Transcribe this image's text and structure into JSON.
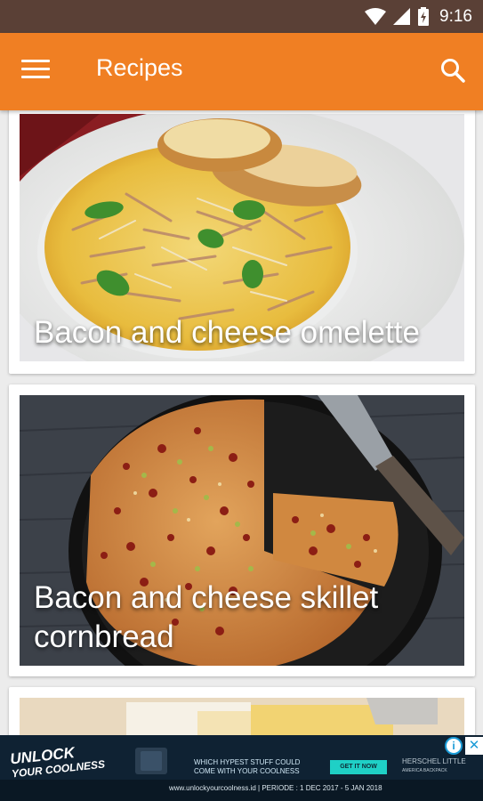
{
  "status_bar": {
    "time": "9:16"
  },
  "app_bar": {
    "title": "Recipes"
  },
  "recipes": [
    {
      "title": "Bacon and cheese omelette"
    },
    {
      "title": "Bacon and cheese skillet cornbread"
    },
    {
      "title": ""
    }
  ],
  "ad": {
    "headline_line1": "UNLOCK",
    "headline_line2": "YOUR COOLNESS",
    "tagline_line1": "WHICH HYPEST STUFF COULD",
    "tagline_line2": "COME WITH YOUR COOLNESS",
    "cta": "GET IT NOW",
    "brand": "HERSCHEL LITTLE",
    "brand_sub": "AMERICA BACKPACK",
    "footer": "www.unlockyourcoolness.id | PERIODE : 1 DEC 2017 - 5 JAN 2018"
  },
  "colors": {
    "primary": "#f07f23",
    "status_bar": "#5a4036"
  }
}
